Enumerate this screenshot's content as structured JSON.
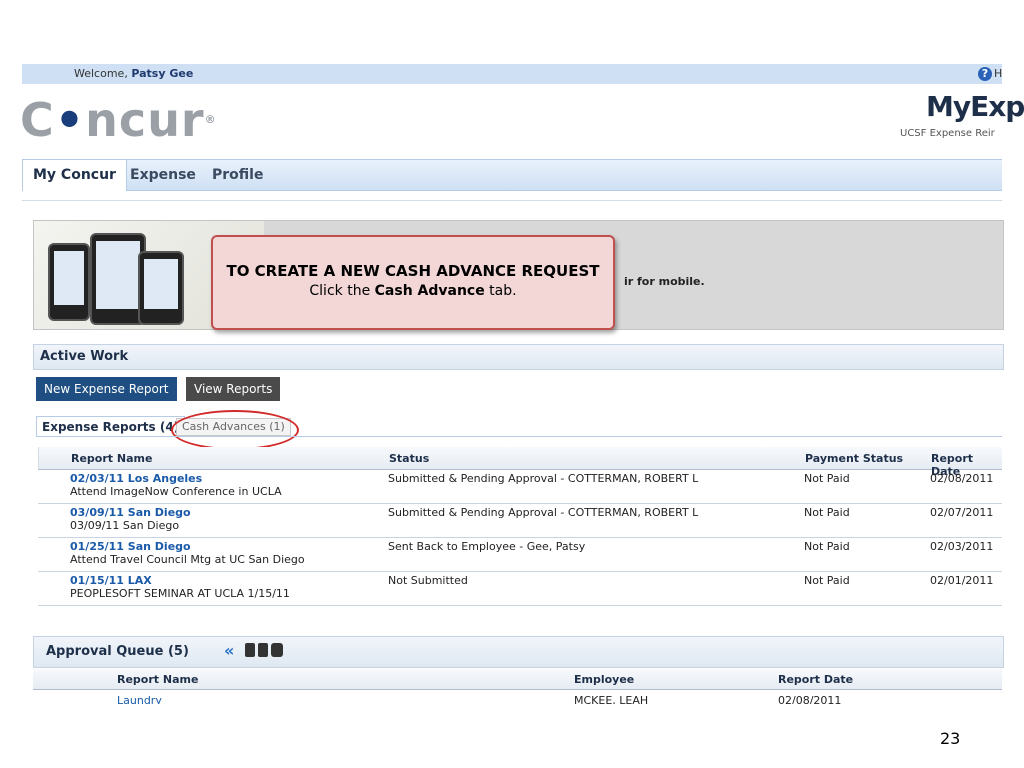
{
  "header": {
    "welcome_prefix": "Welcome,",
    "user_name": "Patsy Gee",
    "help_text": "H"
  },
  "logo": {
    "left": "C",
    "dot": "•",
    "right": "ncur",
    "reg": "®",
    "app_name": "MyExp",
    "app_subtitle": "UCSF Expense Reir"
  },
  "tabs": [
    {
      "label": "My Concur",
      "active": true
    },
    {
      "label": "Expense",
      "active": false
    },
    {
      "label": "Profile",
      "active": false
    }
  ],
  "banner": {
    "text": "ir for mobile."
  },
  "callout": {
    "title": "TO CREATE A NEW CASH ADVANCE REQUEST",
    "body_prefix": "Click the ",
    "body_bold": "Cash Advance",
    "body_suffix": " tab."
  },
  "active_work": {
    "title": "Active Work",
    "new_report_label": "New Expense Report",
    "view_reports_label": "View Reports",
    "subtab_expense": "Expense Reports (4)",
    "subtab_cash": "Cash Advances (1)",
    "columns": [
      "Report Name",
      "Status",
      "Payment Status",
      "Report Date"
    ],
    "rows": [
      {
        "name": "02/03/11 Los Angeles",
        "desc": "Attend ImageNow Conference in UCLA",
        "status": "Submitted & Pending Approval - COTTERMAN, ROBERT L",
        "payment": "Not Paid",
        "date": "02/08/2011"
      },
      {
        "name": "03/09/11 San Diego",
        "desc": "03/09/11 San Diego",
        "status": "Submitted & Pending Approval - COTTERMAN, ROBERT L",
        "payment": "Not Paid",
        "date": "02/07/2011"
      },
      {
        "name": "01/25/11 San Diego",
        "desc": "Attend Travel Council Mtg at UC San Diego",
        "status": "Sent Back to Employee - Gee, Patsy",
        "payment": "Not Paid",
        "date": "02/03/2011"
      },
      {
        "name": "01/15/11 LAX",
        "desc": "PEOPLESOFT SEMINAR AT UCLA 1/15/11",
        "status": "Not Submitted",
        "payment": "Not Paid",
        "date": "02/01/2011"
      }
    ]
  },
  "approval_queue": {
    "title": "Approval Queue (5)",
    "collapse_symbol": "«",
    "columns": [
      "Report Name",
      "Employee",
      "Report Date"
    ],
    "first_row": {
      "name": "Laundry",
      "employee": "MCKEE, LEAH",
      "date": "02/08/2011"
    }
  },
  "slide_number": "23",
  "colors": {
    "accent": "#1a5aa8",
    "callout_border": "#c0504d",
    "highlight": "#d12b2b"
  }
}
